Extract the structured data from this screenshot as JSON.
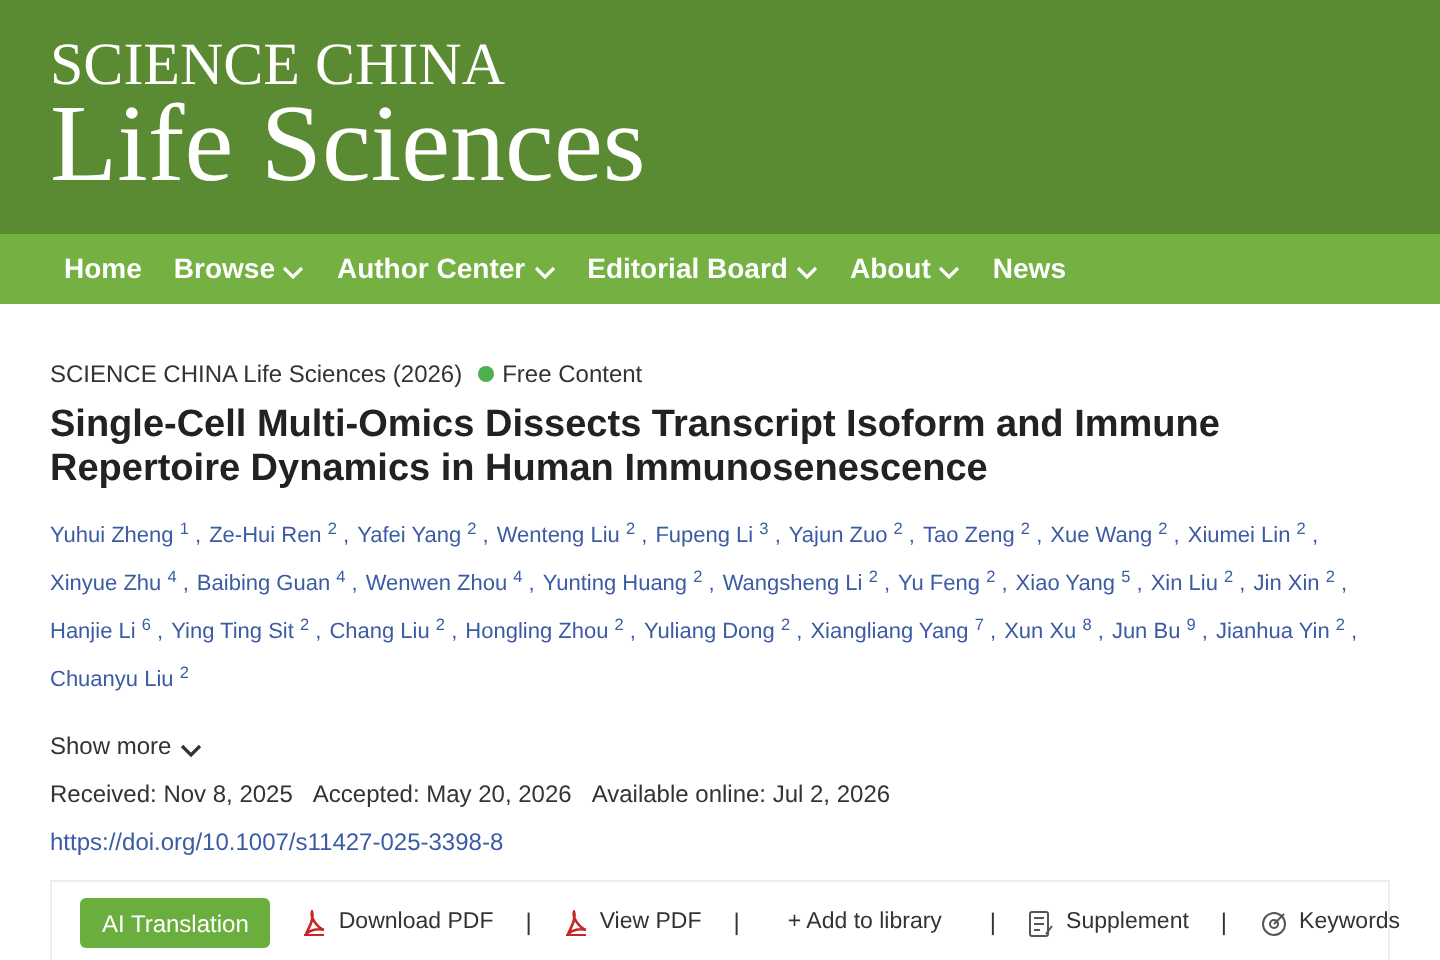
{
  "header": {
    "logo_top": "SCIENCE CHINA",
    "logo_bottom": "Life Sciences"
  },
  "nav": [
    {
      "label": "Home",
      "dropdown": false
    },
    {
      "label": "Browse",
      "dropdown": true
    },
    {
      "label": "Author Center",
      "dropdown": true
    },
    {
      "label": "Editorial Board",
      "dropdown": true
    },
    {
      "label": "About",
      "dropdown": true
    },
    {
      "label": "News",
      "dropdown": false
    }
  ],
  "article": {
    "journal": "SCIENCE CHINA Life Sciences (2026)",
    "access": {
      "label": "Free Content",
      "color": "#4caf50"
    },
    "title": "Single-Cell Multi-Omics Dissects Transcript Isoform and Immune Repertoire Dynamics in Human Immunosenescence",
    "author_lines": [
      [
        "Yuhui Zheng $^{1}$ ,",
        "Ze-Hui Ren $^{2}$ ,",
        "Yafei Yang $^{2}$ ,",
        "Wenteng Liu $^{2}$ ,",
        "Fupeng Li $^{3}$ ,",
        "Yajun Zuo $^{2}$ ,",
        "Tao Zeng $^{2}$ ,",
        "Xue Wang $^{2}$ ,",
        "Xiumei Lin $^{2}$ ,"
      ],
      [
        "Xinyue Zhu $^{4}$ ,",
        "Baibing Guan $^{4}$ ,",
        "Wenwen Zhou $^{4}$ ,",
        "Yunting Huang $^{2}$ ,",
        "Wangsheng Li $^{2}$ ,",
        "Yu Feng $^{2}$ ,",
        "Xiao Yang $^{5}$ ,",
        "Xin Liu $^{2}$ ,",
        "Jin Xin $^{2}$ ,"
      ],
      [
        "Hanjie Li $^{6}$ ,",
        "Ying Ting Sit $^{2}$ ,",
        "Chang Liu $^{2}$ ,",
        "Hongling Zhou $^{2}$ ,",
        "Yuliang Dong $^{2}$ ,",
        "Xiangliang Yang $^{7}$ ,",
        "Xun Xu $^{8}$ ,",
        "Jun Bu $^{9}$ ,",
        "Jianhua Yin $^{2}$ ,"
      ],
      [
        "Chuanyu Liu $^{2}$"
      ]
    ],
    "show_more": "Show more",
    "dates": [
      "Received: Nov 8, 2025",
      "Accepted: May 20, 2026",
      "Available online: Jul 2, 2026"
    ],
    "doi": "https://doi.org/10.1007/s11427-025-3398-8"
  },
  "toolbar": [
    {
      "kind": "primary",
      "label": "AI Translation"
    },
    {
      "kind": "pdf",
      "label": "Download PDF"
    },
    {
      "kind": "sep",
      "label": "|"
    },
    {
      "kind": "pdf",
      "label": "View PDF"
    },
    {
      "kind": "sep",
      "label": "|"
    },
    {
      "kind": "plain",
      "label": "+ Add to library"
    },
    {
      "kind": "sep",
      "label": "|"
    },
    {
      "kind": "doc",
      "label": "Supplement"
    },
    {
      "kind": "sep",
      "label": "|"
    },
    {
      "kind": "tag",
      "label": "Keywords"
    }
  ]
}
